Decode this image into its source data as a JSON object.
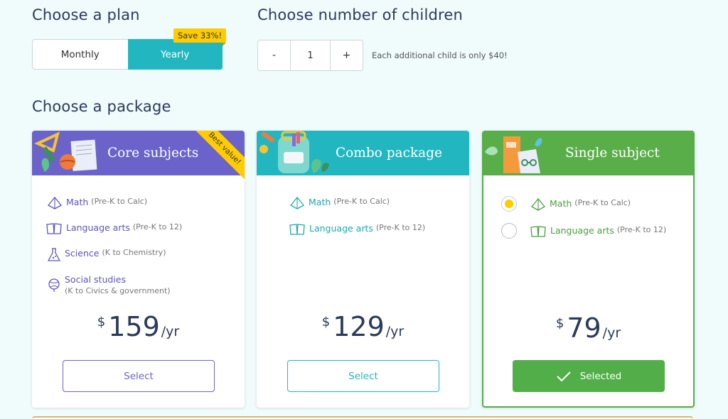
{
  "plan": {
    "title": "Choose a plan",
    "options": [
      "Monthly",
      "Yearly"
    ],
    "selected": "Yearly",
    "save_badge": "Save 33%!"
  },
  "children": {
    "title": "Choose number of children",
    "minus": "-",
    "value": "1",
    "plus": "+",
    "note": "Each additional child is only $40!"
  },
  "package": {
    "title": "Choose a package",
    "cards": [
      {
        "title": "Core subjects",
        "ribbon": "Best value!",
        "color": "#6b63c9",
        "subjects": [
          {
            "name": "Math",
            "range": "(Pre-K to Calc)",
            "icon": "math-pyramid-icon"
          },
          {
            "name": "Language arts",
            "range": "(Pre-K to 12)",
            "icon": "book-icon"
          },
          {
            "name": "Science",
            "range": "(K to Chemistry)",
            "icon": "flask-icon"
          },
          {
            "name": "Social studies",
            "range": "(K to Civics & government)",
            "icon": "globe-icon"
          }
        ],
        "currency": "$",
        "amount": "159",
        "period": "/yr",
        "button": "Select"
      },
      {
        "title": "Combo package",
        "color": "#22b7c0",
        "subjects": [
          {
            "name": "Math",
            "range": "(Pre-K to Calc)",
            "icon": "math-pyramid-icon"
          },
          {
            "name": "Language arts",
            "range": "(Pre-K to 12)",
            "icon": "book-icon"
          }
        ],
        "currency": "$",
        "amount": "129",
        "period": "/yr",
        "button": "Select"
      },
      {
        "title": "Single subject",
        "color": "#5aae4a",
        "subjects": [
          {
            "name": "Math",
            "range": "(Pre-K to Calc)",
            "icon": "math-pyramid-icon",
            "selected": true
          },
          {
            "name": "Language arts",
            "range": "(Pre-K to 12)",
            "icon": "book-icon",
            "selected": false
          }
        ],
        "currency": "$",
        "amount": "79",
        "period": "/yr",
        "button": "Selected"
      }
    ]
  }
}
